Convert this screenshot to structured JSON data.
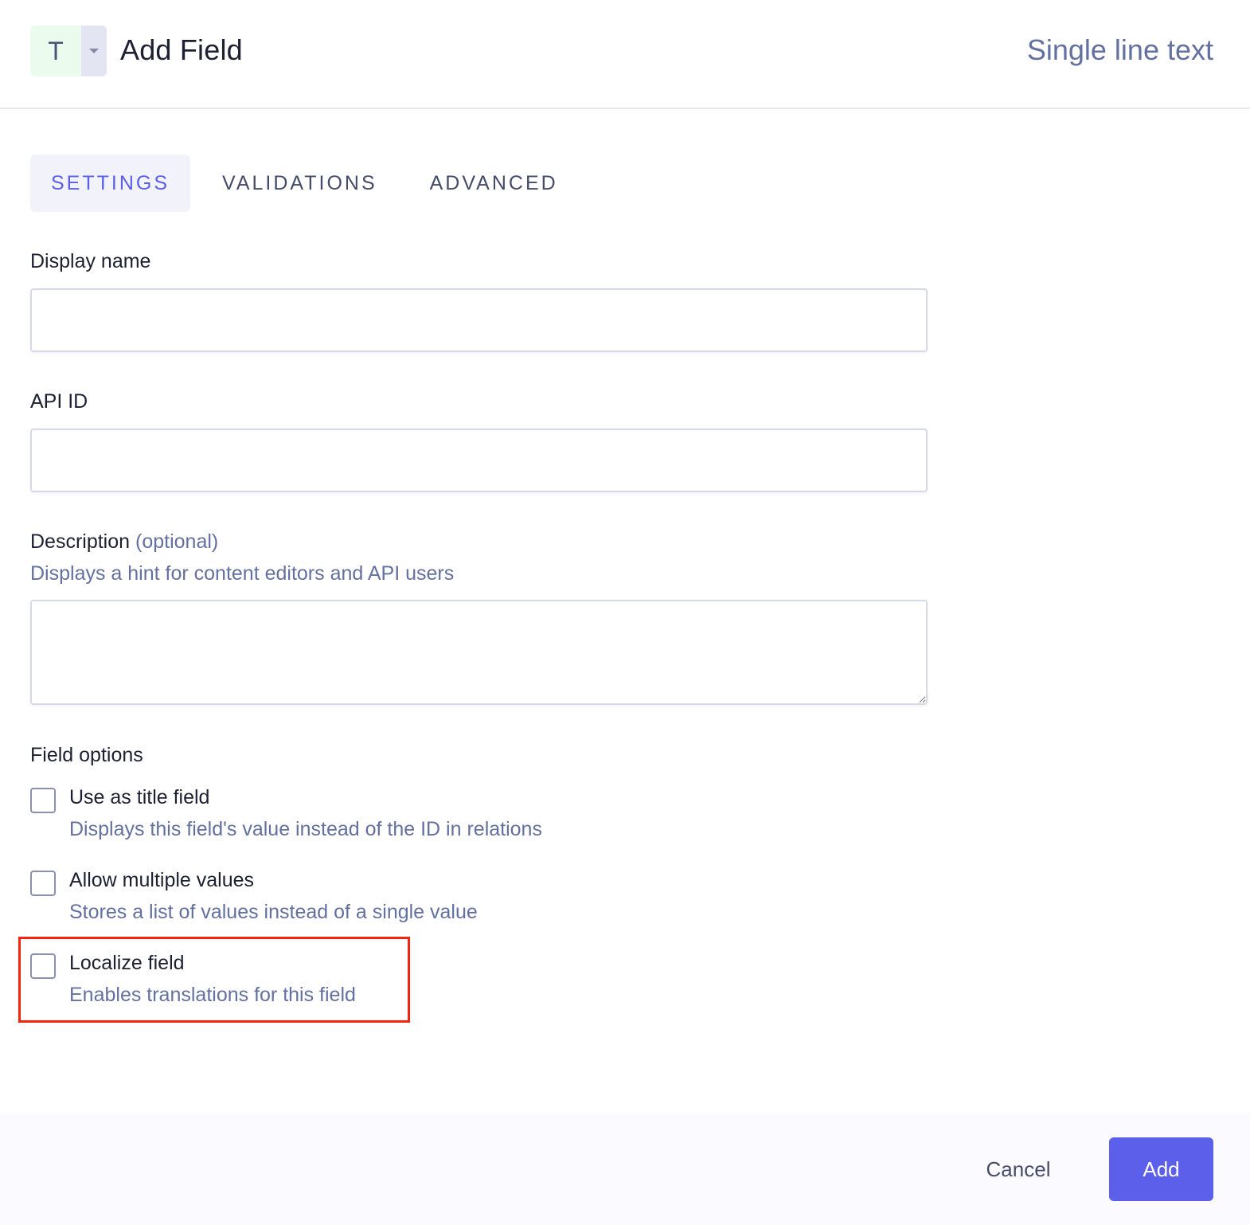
{
  "header": {
    "type_icon_glyph": "T",
    "type_icon_name": "text-type-icon",
    "title": "Add Field",
    "field_type": "Single line text"
  },
  "tabs": [
    {
      "label": "SETTINGS",
      "active": true
    },
    {
      "label": "VALIDATIONS",
      "active": false
    },
    {
      "label": "ADVANCED",
      "active": false
    }
  ],
  "form": {
    "display_name": {
      "label": "Display name",
      "value": "",
      "placeholder": ""
    },
    "api_id": {
      "label": "API ID",
      "value": "",
      "placeholder": ""
    },
    "description": {
      "label": "Description",
      "optional_label": "(optional)",
      "hint": "Displays a hint for content editors and API users",
      "value": ""
    },
    "field_options": {
      "heading": "Field options",
      "items": [
        {
          "label": "Use as title field",
          "hint": "Displays this field's value instead of the ID in relations",
          "checked": false
        },
        {
          "label": "Allow multiple values",
          "hint": "Stores a list of values instead of a single value",
          "checked": false
        },
        {
          "label": "Localize field",
          "hint": "Enables translations for this field",
          "checked": false,
          "highlighted": true
        }
      ]
    }
  },
  "footer": {
    "cancel_label": "Cancel",
    "add_label": "Add"
  },
  "colors": {
    "accent": "#5b5fe9",
    "active_tab_text": "#5b5fe6",
    "muted_text": "#6470a0",
    "highlight_border": "#f4240f",
    "type_icon_bg": "#ebfcee"
  }
}
